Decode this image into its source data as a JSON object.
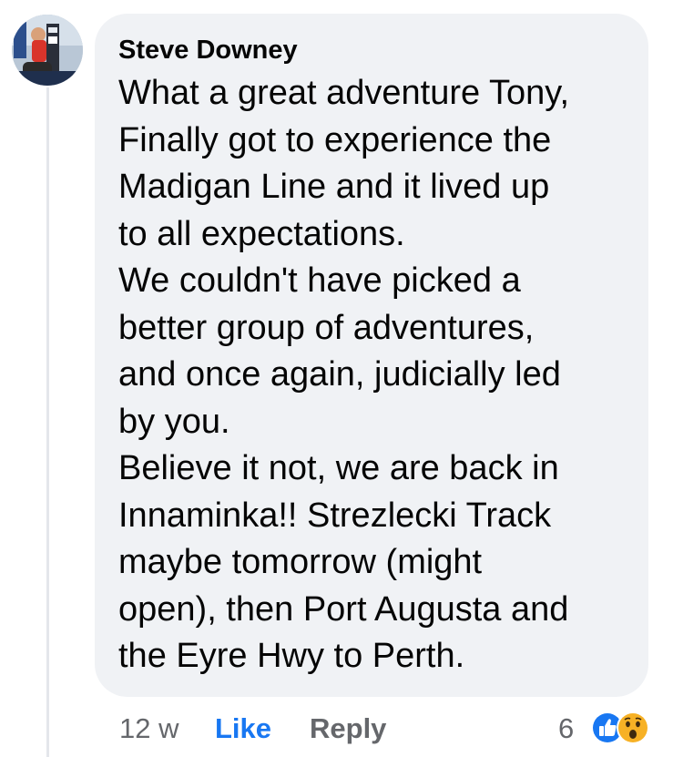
{
  "comment": {
    "author": "Steve Downey",
    "text_lines": [
      "What a great adventure Tony,",
      "Finally got to experience the",
      "Madigan Line and it lived up",
      "to all expectations.",
      "We couldn't have picked a",
      "better group of adventures,",
      "and once again, judicially led",
      "by you.",
      "Believe it not, we are back in",
      "Innaminka!! Strezlecki Track",
      "maybe tomorrow (might",
      "open), then Port Augusta and",
      "the Eyre Hwy to Perth."
    ]
  },
  "meta": {
    "timestamp": "12 w",
    "like_label": "Like",
    "reply_label": "Reply",
    "reaction_count": "6",
    "reactions": [
      "like-icon",
      "wow-icon"
    ]
  },
  "colors": {
    "bubble_bg": "#f0f2f5",
    "like_blue": "#1877f2",
    "meta_gray": "#65676b",
    "text": "#050505",
    "wow_yellow": "#f7b125"
  }
}
